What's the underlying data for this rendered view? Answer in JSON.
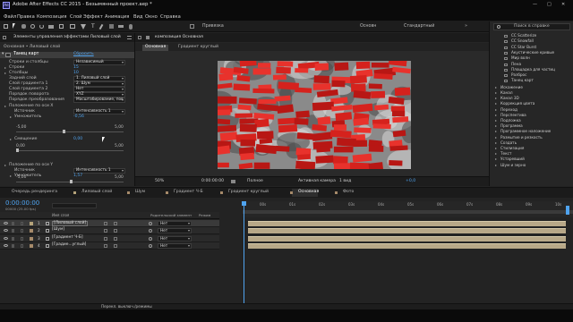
{
  "app": {
    "title": "Adobe After Effects CC 2015 - Безымянный проект.aep *",
    "window_controls": {
      "minimize": "—",
      "maximize": "□",
      "close": "✕"
    }
  },
  "menu": [
    "Файл",
    "Правка",
    "Композиция",
    "Слой",
    "Эффект",
    "Анимация",
    "Вид",
    "Окно",
    "Справка"
  ],
  "toolbar": {
    "snap_label": "Привязка",
    "workspaces": [
      "Основн",
      "Стандартный"
    ],
    "search_placeholder": "Поиск в справке"
  },
  "effects_panel": {
    "tab_label": "Элементы управления эффектами Лиловый слой",
    "breadcrumb": "Основная • Лиловый слой",
    "effect": {
      "name": "Танец карт",
      "reset_label": "Сбросить"
    },
    "rows": [
      {
        "label": "Строки и столбцы",
        "value": "Независимый",
        "kind": "dropdown"
      },
      {
        "label": "Строки",
        "value": "15",
        "kind": "blue"
      },
      {
        "label": "Столбцы",
        "value": "10",
        "kind": "blue"
      },
      {
        "label": "Задний слой",
        "value": "1. Лиловый слой",
        "kind": "dropdown"
      },
      {
        "label": "Слой градиента 1",
        "value": "2. Шум",
        "kind": "dropdown"
      },
      {
        "label": "Слой градиента 2",
        "value": "Нет",
        "kind": "dropdown"
      },
      {
        "label": "Порядок поворота",
        "value": "XYZ",
        "kind": "dropdown"
      },
      {
        "label": "Порядок преобразования",
        "value": "Масштабирование, пов",
        "kind": "dropdown"
      },
      {
        "label": "Положение по оси X",
        "value": "",
        "kind": "group"
      },
      {
        "label": "Источник",
        "value": "Интенсивность 1",
        "kind": "dropdown"
      },
      {
        "label": "Умножитель",
        "value": "-0,56",
        "kind": "blue"
      },
      {
        "label": "Смещение",
        "value": "0,00",
        "kind": "blue"
      },
      {
        "label": "Положение по оси Y",
        "value": "",
        "kind": "group"
      },
      {
        "label": "Источник",
        "value": "Интенсивность 1",
        "kind": "dropdown"
      },
      {
        "label": "Умножитель",
        "value": "1,57",
        "kind": "blue"
      }
    ],
    "slider_a": {
      "min": "-5,00",
      "max": "5,00"
    },
    "slider_b": {
      "min": "0,00",
      "max": "5,00"
    },
    "slider_c": {
      "min": "-5,00",
      "max": "5,00"
    }
  },
  "comp_panel": {
    "tab_label": "композиция Основная",
    "sub_tabs": [
      "Основная",
      "Градиент круглый"
    ],
    "footer": {
      "zoom": "50%",
      "time": "0:00:00:00",
      "quality": "Полное",
      "camera": "Активная камера",
      "views": "1 вид",
      "exposure": "+0,0"
    }
  },
  "right_panel": {
    "effects": [
      "CC Scatterize",
      "CC Snowfall",
      "CC Star Burst",
      "Акустические кривые",
      "Мир волн",
      "Пена",
      "Площадка для частиц",
      "Разброс",
      "Танец карт"
    ],
    "categories": [
      "Искажение",
      "Канал",
      "Канал 3D",
      "Коррекция цвета",
      "Переход",
      "Перспектива",
      "Подложка",
      "Программа",
      "Программное наложение",
      "Размытие и резкость",
      "Создать",
      "Стилизация",
      "Текст",
      "Устаревший",
      "Шум и зерно"
    ]
  },
  "bottom_tabs": [
    "Очередь рендеринга",
    "Лиловый слой",
    "Шум",
    "Градиент Ч-Б",
    "Градиент круглый",
    "Основная",
    "Фото"
  ],
  "timeline": {
    "timecode": "0:00:00:00",
    "fps": "00000 (25.00 fps)",
    "columns": {
      "name": "Имя слоя",
      "parent": "Родительский элемент",
      "mode": "Режим"
    },
    "layers": [
      {
        "num": "1",
        "name": "[Лиловый слой]",
        "parent": "Нет",
        "color": "#b5a37a"
      },
      {
        "num": "2",
        "name": "[Шум]",
        "parent": "Нет",
        "color": "#a68a6a"
      },
      {
        "num": "3",
        "name": "[Градиент Ч-Б]",
        "parent": "Нет",
        "color": "#a68a6a"
      },
      {
        "num": "4",
        "name": "[Градие...углый]",
        "parent": "Нет",
        "color": "#a68a6a"
      }
    ],
    "ruler": [
      "00s",
      "01s",
      "02s",
      "03s",
      "04s",
      "05s",
      "06s",
      "07s",
      "08s",
      "09s",
      "10s"
    ],
    "switch_label": "Перекл. выключ./режимы"
  },
  "colors": {
    "accent": "#4fa3ef",
    "red": "#d5221d",
    "track": "#b8a888",
    "bg": "#232323"
  }
}
